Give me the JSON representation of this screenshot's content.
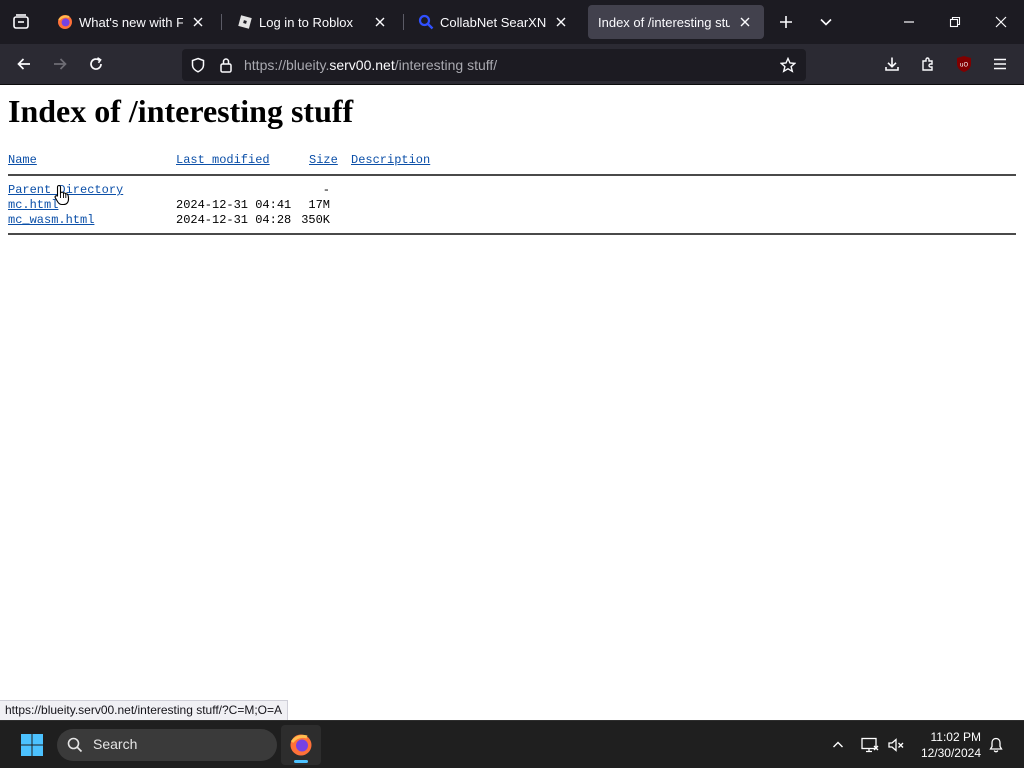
{
  "browser": {
    "tabs": [
      {
        "label": "What's new with Firefox",
        "icon": "firefox-icon",
        "active": false
      },
      {
        "label": "Log in to Roblox",
        "icon": "roblox-icon",
        "active": false
      },
      {
        "label": "CollabNet SearXNG",
        "icon": "search-icon",
        "active": false
      },
      {
        "label": "Index of /interesting stuff",
        "icon": "none",
        "active": true
      }
    ],
    "url": {
      "prefix": "https://blueity.",
      "host": "serv00.net",
      "path": "/interesting stuff/"
    },
    "status_url": "https://blueity.serv00.net/interesting stuff/?C=M;O=A"
  },
  "page": {
    "title": "Index of /interesting stuff",
    "columns": {
      "name": "Name",
      "last_modified": "Last modified",
      "size": "Size",
      "description": "Description"
    },
    "rows": [
      {
        "name": "Parent Directory",
        "modified": "",
        "size": "-",
        "description": ""
      },
      {
        "name": "mc.html",
        "modified": "2024-12-31 04:41",
        "size": "17M",
        "description": ""
      },
      {
        "name": "mc_wasm.html",
        "modified": "2024-12-31 04:28",
        "size": "350K",
        "description": ""
      }
    ]
  },
  "taskbar": {
    "search_placeholder": "Search",
    "time": "11:02 PM",
    "date": "12/30/2024"
  },
  "colors": {
    "link": "#0b4fa8",
    "active_tab": "#42414d",
    "accent": "#4cc2ff"
  }
}
